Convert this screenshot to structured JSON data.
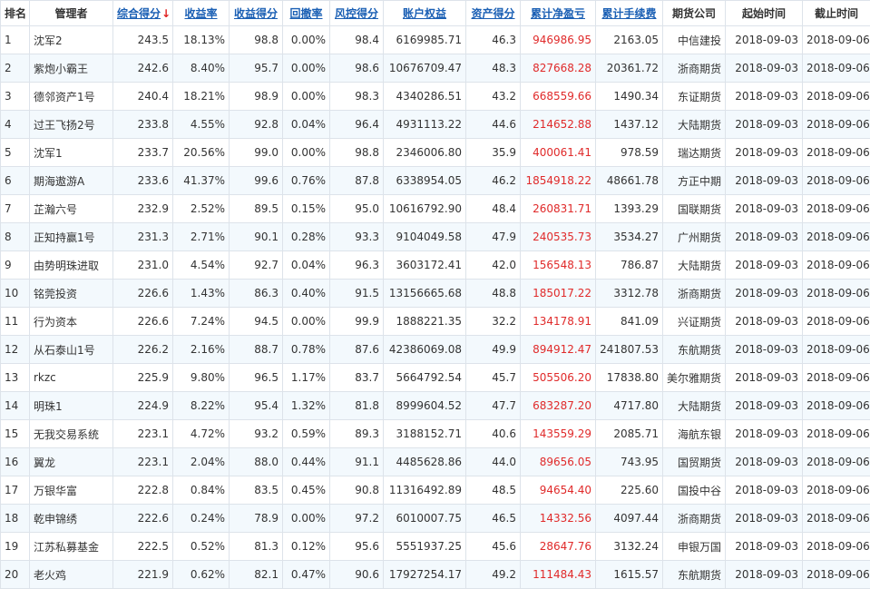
{
  "headers": {
    "rank": "排名",
    "manager": "管理者",
    "total_score": "综合得分",
    "sort_arrow": "↓",
    "return_rate": "收益率",
    "return_score": "收益得分",
    "drawdown": "回撤率",
    "risk_score": "风控得分",
    "equity": "账户权益",
    "asset_score": "资产得分",
    "net_profit": "累计净盈亏",
    "fees": "累计手续费",
    "broker": "期货公司",
    "start_date": "起始时间",
    "end_date": "截止时间"
  },
  "colors": {
    "link_header": "#1a5fb4",
    "profit_red": "#e02a2a",
    "row_stripe": "#f3f9fd",
    "border": "#dde3ea"
  },
  "rows": [
    {
      "rank": "1",
      "manager": "沈军2",
      "total_score": "243.5",
      "return_rate": "18.13%",
      "return_score": "98.8",
      "drawdown": "0.00%",
      "risk_score": "98.4",
      "equity": "6169985.71",
      "asset_score": "46.3",
      "net_profit": "946986.95",
      "fees": "2163.05",
      "broker": "中信建投",
      "start_date": "2018-09-03",
      "end_date": "2018-09-06"
    },
    {
      "rank": "2",
      "manager": "紫炮小霸王",
      "total_score": "242.6",
      "return_rate": "8.40%",
      "return_score": "95.7",
      "drawdown": "0.00%",
      "risk_score": "98.6",
      "equity": "10676709.47",
      "asset_score": "48.3",
      "net_profit": "827668.28",
      "fees": "20361.72",
      "broker": "浙商期货",
      "start_date": "2018-09-03",
      "end_date": "2018-09-06"
    },
    {
      "rank": "3",
      "manager": "德邻资产1号",
      "total_score": "240.4",
      "return_rate": "18.21%",
      "return_score": "98.9",
      "drawdown": "0.00%",
      "risk_score": "98.3",
      "equity": "4340286.51",
      "asset_score": "43.2",
      "net_profit": "668559.66",
      "fees": "1490.34",
      "broker": "东证期货",
      "start_date": "2018-09-03",
      "end_date": "2018-09-06"
    },
    {
      "rank": "4",
      "manager": "过王飞扬2号",
      "total_score": "233.8",
      "return_rate": "4.55%",
      "return_score": "92.8",
      "drawdown": "0.04%",
      "risk_score": "96.4",
      "equity": "4931113.22",
      "asset_score": "44.6",
      "net_profit": "214652.88",
      "fees": "1437.12",
      "broker": "大陆期货",
      "start_date": "2018-09-03",
      "end_date": "2018-09-06"
    },
    {
      "rank": "5",
      "manager": "沈军1",
      "total_score": "233.7",
      "return_rate": "20.56%",
      "return_score": "99.0",
      "drawdown": "0.00%",
      "risk_score": "98.8",
      "equity": "2346006.80",
      "asset_score": "35.9",
      "net_profit": "400061.41",
      "fees": "978.59",
      "broker": "瑞达期货",
      "start_date": "2018-09-03",
      "end_date": "2018-09-06"
    },
    {
      "rank": "6",
      "manager": "期海遨游A",
      "total_score": "233.6",
      "return_rate": "41.37%",
      "return_score": "99.6",
      "drawdown": "0.76%",
      "risk_score": "87.8",
      "equity": "6338954.05",
      "asset_score": "46.2",
      "net_profit": "1854918.22",
      "fees": "48661.78",
      "broker": "方正中期",
      "start_date": "2018-09-03",
      "end_date": "2018-09-06"
    },
    {
      "rank": "7",
      "manager": "芷瀚六号",
      "total_score": "232.9",
      "return_rate": "2.52%",
      "return_score": "89.5",
      "drawdown": "0.15%",
      "risk_score": "95.0",
      "equity": "10616792.90",
      "asset_score": "48.4",
      "net_profit": "260831.71",
      "fees": "1393.29",
      "broker": "国联期货",
      "start_date": "2018-09-03",
      "end_date": "2018-09-06"
    },
    {
      "rank": "8",
      "manager": "正知持赢1号",
      "total_score": "231.3",
      "return_rate": "2.71%",
      "return_score": "90.1",
      "drawdown": "0.28%",
      "risk_score": "93.3",
      "equity": "9104049.58",
      "asset_score": "47.9",
      "net_profit": "240535.73",
      "fees": "3534.27",
      "broker": "广州期货",
      "start_date": "2018-09-03",
      "end_date": "2018-09-06"
    },
    {
      "rank": "9",
      "manager": "由势明珠进取",
      "total_score": "231.0",
      "return_rate": "4.54%",
      "return_score": "92.7",
      "drawdown": "0.04%",
      "risk_score": "96.3",
      "equity": "3603172.41",
      "asset_score": "42.0",
      "net_profit": "156548.13",
      "fees": "786.87",
      "broker": "大陆期货",
      "start_date": "2018-09-03",
      "end_date": "2018-09-06"
    },
    {
      "rank": "10",
      "manager": "铭莞投资",
      "total_score": "226.6",
      "return_rate": "1.43%",
      "return_score": "86.3",
      "drawdown": "0.40%",
      "risk_score": "91.5",
      "equity": "13156665.68",
      "asset_score": "48.8",
      "net_profit": "185017.22",
      "fees": "3312.78",
      "broker": "浙商期货",
      "start_date": "2018-09-03",
      "end_date": "2018-09-06"
    },
    {
      "rank": "11",
      "manager": "行为资本",
      "total_score": "226.6",
      "return_rate": "7.24%",
      "return_score": "94.5",
      "drawdown": "0.00%",
      "risk_score": "99.9",
      "equity": "1888221.35",
      "asset_score": "32.2",
      "net_profit": "134178.91",
      "fees": "841.09",
      "broker": "兴证期货",
      "start_date": "2018-09-03",
      "end_date": "2018-09-06"
    },
    {
      "rank": "12",
      "manager": "从石泰山1号",
      "total_score": "226.2",
      "return_rate": "2.16%",
      "return_score": "88.7",
      "drawdown": "0.78%",
      "risk_score": "87.6",
      "equity": "42386069.08",
      "asset_score": "49.9",
      "net_profit": "894912.47",
      "fees": "241807.53",
      "broker": "东航期货",
      "start_date": "2018-09-03",
      "end_date": "2018-09-06"
    },
    {
      "rank": "13",
      "manager": "rkzc",
      "total_score": "225.9",
      "return_rate": "9.80%",
      "return_score": "96.5",
      "drawdown": "1.17%",
      "risk_score": "83.7",
      "equity": "5664792.54",
      "asset_score": "45.7",
      "net_profit": "505506.20",
      "fees": "17838.80",
      "broker": "美尔雅期货",
      "start_date": "2018-09-03",
      "end_date": "2018-09-06"
    },
    {
      "rank": "14",
      "manager": "明珠1",
      "total_score": "224.9",
      "return_rate": "8.22%",
      "return_score": "95.4",
      "drawdown": "1.32%",
      "risk_score": "81.8",
      "equity": "8999604.52",
      "asset_score": "47.7",
      "net_profit": "683287.20",
      "fees": "4717.80",
      "broker": "大陆期货",
      "start_date": "2018-09-03",
      "end_date": "2018-09-06"
    },
    {
      "rank": "15",
      "manager": "无我交易系统",
      "total_score": "223.1",
      "return_rate": "4.72%",
      "return_score": "93.2",
      "drawdown": "0.59%",
      "risk_score": "89.3",
      "equity": "3188152.71",
      "asset_score": "40.6",
      "net_profit": "143559.29",
      "fees": "2085.71",
      "broker": "海航东银",
      "start_date": "2018-09-03",
      "end_date": "2018-09-06"
    },
    {
      "rank": "16",
      "manager": "翼龙",
      "total_score": "223.1",
      "return_rate": "2.04%",
      "return_score": "88.0",
      "drawdown": "0.44%",
      "risk_score": "91.1",
      "equity": "4485628.86",
      "asset_score": "44.0",
      "net_profit": "89656.05",
      "fees": "743.95",
      "broker": "国贸期货",
      "start_date": "2018-09-03",
      "end_date": "2018-09-06"
    },
    {
      "rank": "17",
      "manager": "万银华富",
      "total_score": "222.8",
      "return_rate": "0.84%",
      "return_score": "83.5",
      "drawdown": "0.45%",
      "risk_score": "90.8",
      "equity": "11316492.89",
      "asset_score": "48.5",
      "net_profit": "94654.40",
      "fees": "225.60",
      "broker": "国投中谷",
      "start_date": "2018-09-03",
      "end_date": "2018-09-06"
    },
    {
      "rank": "18",
      "manager": "乾申锦绣",
      "total_score": "222.6",
      "return_rate": "0.24%",
      "return_score": "78.9",
      "drawdown": "0.00%",
      "risk_score": "97.2",
      "equity": "6010007.75",
      "asset_score": "46.5",
      "net_profit": "14332.56",
      "fees": "4097.44",
      "broker": "浙商期货",
      "start_date": "2018-09-03",
      "end_date": "2018-09-06"
    },
    {
      "rank": "19",
      "manager": "江苏私募基金",
      "total_score": "222.5",
      "return_rate": "0.52%",
      "return_score": "81.3",
      "drawdown": "0.12%",
      "risk_score": "95.6",
      "equity": "5551937.25",
      "asset_score": "45.6",
      "net_profit": "28647.76",
      "fees": "3132.24",
      "broker": "申银万国",
      "start_date": "2018-09-03",
      "end_date": "2018-09-06"
    },
    {
      "rank": "20",
      "manager": "老火鸡",
      "total_score": "221.9",
      "return_rate": "0.62%",
      "return_score": "82.1",
      "drawdown": "0.47%",
      "risk_score": "90.6",
      "equity": "17927254.17",
      "asset_score": "49.2",
      "net_profit": "111484.43",
      "fees": "1615.57",
      "broker": "东航期货",
      "start_date": "2018-09-03",
      "end_date": "2018-09-06"
    }
  ]
}
